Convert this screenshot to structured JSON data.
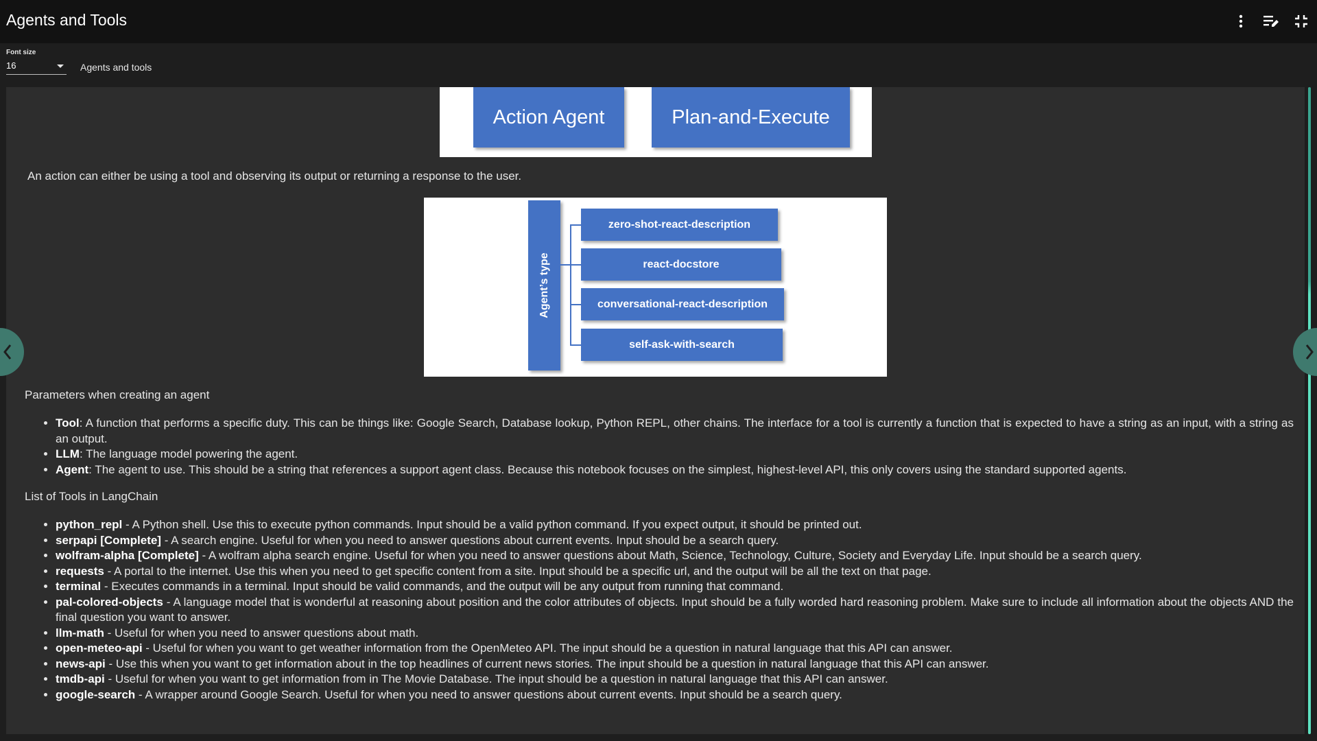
{
  "app": {
    "title": "Agents and Tools"
  },
  "top_actions": [
    {
      "icon": "more-vert-icon"
    },
    {
      "icon": "edit-list-icon"
    },
    {
      "icon": "fullscreen-exit-icon"
    }
  ],
  "toolbar": {
    "font_size_label": "Font size",
    "font_size_value": "16",
    "doc_name": "Agents and tools"
  },
  "diagram_agents": {
    "boxes": [
      "Action Agent",
      "Plan-and-Execute"
    ]
  },
  "action_text": "An action can either be using a tool and observing its output or returning a response to the user.",
  "diagram_types": {
    "bar_label": "Agent’s type",
    "types": [
      "zero-shot-react-description",
      "react-docstore",
      "conversational-react-description",
      "self-ask-with-search"
    ]
  },
  "params": {
    "title": "Parameters when creating an agent",
    "items": [
      {
        "term": "Tool",
        "text": ": A function that performs a specific duty. This can be things like: Google Search, Database lookup, Python REPL, other chains. The interface for a tool is currently a function that is expected to have a string as an input, with a string as an output."
      },
      {
        "term": "LLM",
        "text": ": The language model powering the agent."
      },
      {
        "term": "Agent",
        "text": ": The agent to use. This should be a string that references a support agent class. Because this notebook focuses on the simplest, highest-level API, this only covers using the standard supported agents."
      }
    ]
  },
  "tools": {
    "title": "List of Tools in LangChain",
    "items": [
      {
        "term": "python_repl",
        "text": " - A Python shell. Use this to execute python commands. Input should be a valid python command. If you expect output, it should be printed out."
      },
      {
        "term": "serpapi [Complete]",
        "text": " - A search engine. Useful for when you need to answer questions about current events. Input should be a search query."
      },
      {
        "term": "wolfram-alpha [Complete]",
        "text": " - A wolfram alpha search engine. Useful for when you need to answer questions about Math, Science, Technology, Culture, Society and Everyday Life. Input should be a search query."
      },
      {
        "term": "requests",
        "text": " - A portal to the internet. Use this when you need to get specific content from a site. Input should be a specific url, and the output will be all the text on that page."
      },
      {
        "term": "terminal",
        "text": " - Executes commands in a terminal. Input should be valid commands, and the output will be any output from running that command."
      },
      {
        "term": "pal-colored-objects",
        "text": " - A language model that is wonderful at reasoning about position and the color attributes of objects. Input should be a fully worded hard reasoning problem. Make sure to include all information about the objects AND the final question you want to answer."
      },
      {
        "term": "llm-math",
        "text": " - Useful for when you need to answer questions about math."
      },
      {
        "term": "open-meteo-api",
        "text": " - Useful for when you want to get weather information from the OpenMeteo API. The input should be a question in natural language that this API can answer."
      },
      {
        "term": "news-api",
        "text": " - Use this when you want to get information about in the top headlines of current news stories. The input should be a question in natural language that this API can answer."
      },
      {
        "term": "tmdb-api",
        "text": " - Useful for when you want to get information from in The Movie Database. The input should be a question in natural language that this API can answer."
      },
      {
        "term": "google-search",
        "text": " - A wrapper around Google Search. Useful for when you need to answer questions about current events. Input should be a search query."
      }
    ]
  },
  "colors": {
    "accent": "#4472c4",
    "scroll": "#5de0bf",
    "nav": "#3f7a6e"
  }
}
